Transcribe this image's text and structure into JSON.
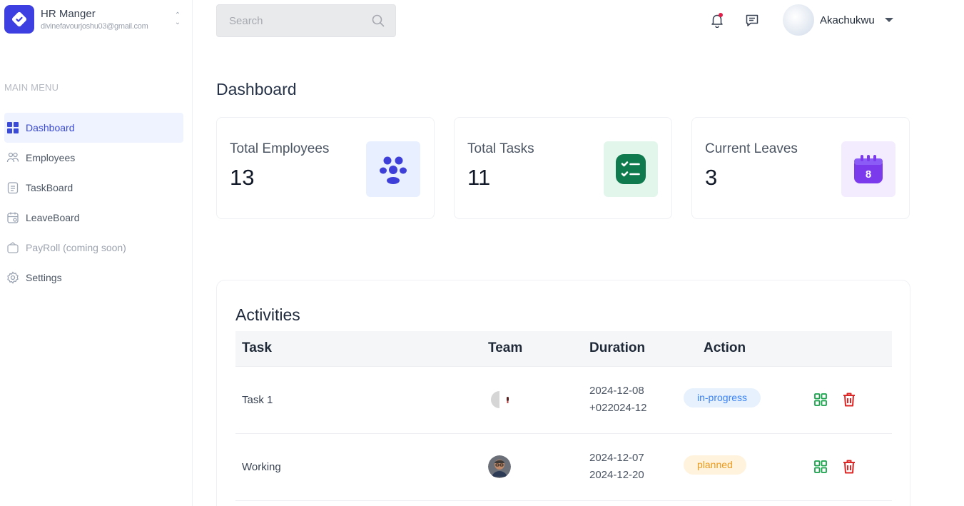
{
  "brand": {
    "title": "HR Manger",
    "email": "divinefavourjoshu03@gmail.com",
    "logo_color": "#3d3fe0"
  },
  "sidebar": {
    "heading": "MAIN MENU",
    "items": [
      {
        "label": "Dashboard",
        "icon": "grid-icon",
        "active": true
      },
      {
        "label": "Employees",
        "icon": "people-icon"
      },
      {
        "label": "TaskBoard",
        "icon": "clipboard-icon"
      },
      {
        "label": "LeaveBoard",
        "icon": "calendar-icon"
      },
      {
        "label": "PayRoll (coming soon)",
        "icon": "wallet-icon",
        "disabled": true
      },
      {
        "label": "Settings",
        "icon": "gear-icon"
      }
    ]
  },
  "search": {
    "placeholder": "Search"
  },
  "user": {
    "name": "Akachukwu"
  },
  "page": {
    "title": "Dashboard"
  },
  "stats": [
    {
      "label": "Total Employees",
      "value": "13",
      "icon": "people-group-icon",
      "bg": "#e8f0ff",
      "fg": "#3d3fd8"
    },
    {
      "label": "Total Tasks",
      "value": "11",
      "icon": "checklist-icon",
      "bg": "#e3f6ec",
      "fg": "#0f7a4d"
    },
    {
      "label": "Current Leaves",
      "value": "3",
      "icon": "calendar-date-icon",
      "icon_text": "8",
      "bg": "#f3ecff",
      "fg": "#7c3aed"
    }
  ],
  "activities": {
    "title": "Activities",
    "columns": {
      "task": "Task",
      "team": "Team",
      "duration": "Duration",
      "action": "Action"
    },
    "rows": [
      {
        "task": "Task 1",
        "start": "2024-12-08",
        "end": "+022024-12",
        "status": "in-progress"
      },
      {
        "task": "Working",
        "start": "2024-12-07",
        "end": "2024-12-20",
        "status": "planned"
      }
    ]
  },
  "colors": {
    "accent": "#3b4bd6",
    "edit": "#16a34a",
    "delete": "#dc2626"
  }
}
